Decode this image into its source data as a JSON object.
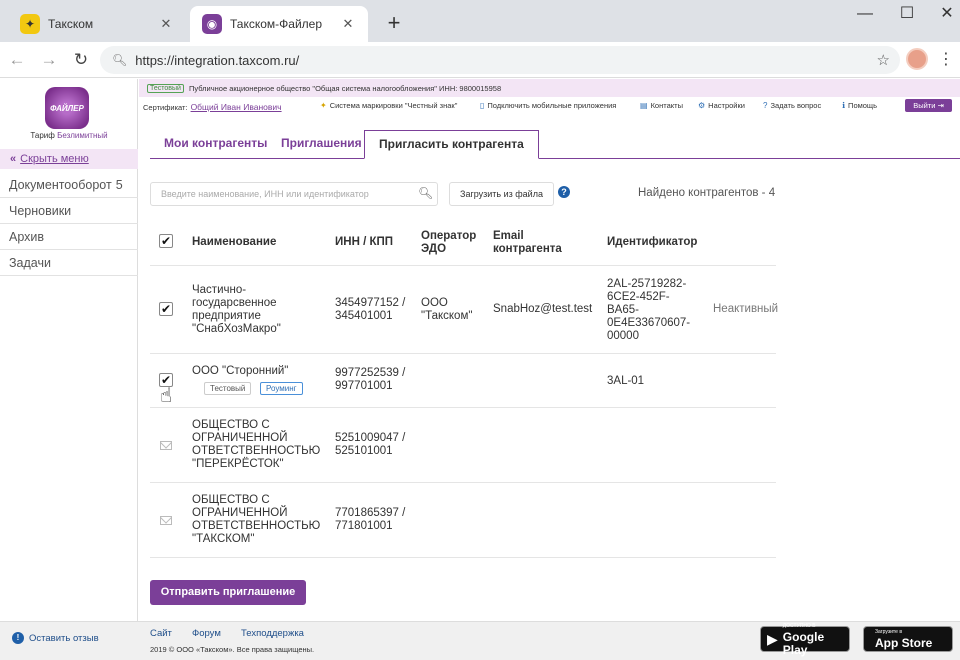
{
  "browser": {
    "tabs": [
      {
        "title": "Такском",
        "active": false
      },
      {
        "title": "Такском-Файлер",
        "active": true
      }
    ],
    "url": "https://integration.taxcom.ru/"
  },
  "sidebar": {
    "logo_text": "ФАЙЛЕР",
    "tariff_label": "Тариф",
    "tariff_value": "Безлимитный",
    "collapse_label": "Скрыть меню",
    "items": [
      {
        "label": "Документооборот",
        "count": "5"
      },
      {
        "label": "Черновики",
        "count": ""
      },
      {
        "label": "Архив",
        "count": ""
      },
      {
        "label": "Задачи",
        "count": ""
      }
    ]
  },
  "header": {
    "test_badge": "Тестовый",
    "org_info": "Публичное акционерное общество \"Общая система налогообложения\" ИНН: 9800015958",
    "cert_label": "Сертификат:",
    "cert_name": "Общий Иван Иванович",
    "links": {
      "marking": "Система маркировки \"Честный знак\"",
      "mobile": "Подключить мобильные приложения",
      "contacts": "Контакты",
      "settings": "Настройки",
      "ask": "Задать вопрос",
      "help": "Помощь"
    },
    "exit_label": "Выйти"
  },
  "tabs": {
    "counterparties": "Мои контрагенты",
    "invitations": "Приглашения",
    "invite": "Пригласить контрагента"
  },
  "search": {
    "placeholder": "Введите наименование, ИНН или идентификатор",
    "upload_label": "Загрузить из файла",
    "found_label": "Найдено контрагентов - 4"
  },
  "table": {
    "headers": {
      "name": "Наименование",
      "inn": "ИНН / КПП",
      "operator_1": "Оператор",
      "operator_2": "ЭДО",
      "email_1": "Email",
      "email_2": "контрагента",
      "id": "Идентификатор"
    },
    "rows": [
      {
        "name_lines": [
          "Частично-",
          "государсвенное",
          "предприятие",
          "\"СнабХозМакро\""
        ],
        "inn": "3454977152 /",
        "kpp": "345401001",
        "operator_1": "ООО",
        "operator_2": "\"Такском\"",
        "email": "SnabHoz@test.test",
        "id_lines": [
          "2AL-25719282-",
          "6CE2-452F-",
          "BA65-",
          "0E4E33670607-",
          "00000"
        ],
        "status": "Неактивный"
      },
      {
        "name_lines": [
          "ООО \"Сторонний\""
        ],
        "tag_test": "Тестовый",
        "tag_roaming": "Роуминг",
        "inn": "9977252539 /",
        "kpp": "997701001",
        "id_lines": [
          "3AL-01"
        ]
      },
      {
        "name_lines": [
          "ОБЩЕСТВО С",
          "ОГРАНИЧЕННОЙ",
          "ОТВЕТСТВЕННОСТЬЮ",
          "\"ПЕРЕКРЁСТОК\""
        ],
        "inn": "5251009047 /",
        "kpp": "525101001"
      },
      {
        "name_lines": [
          "ОБЩЕСТВО С",
          "ОГРАНИЧЕННОЙ",
          "ОТВЕТСТВЕННОСТЬЮ",
          "\"ТАКСКОМ\""
        ],
        "inn": "7701865397 /",
        "kpp": "771801001"
      }
    ]
  },
  "send_button": "Отправить приглашение",
  "footer": {
    "feedback": "Оставить отзыв",
    "links": [
      "Сайт",
      "Форум",
      "Техподдержка"
    ],
    "copyright": "2019 © ООО «Такском». Все права защищены.",
    "google_small": "ДОСТУПНО В",
    "google_big": "Google Play",
    "apple_small": "Загрузите в",
    "apple_big": "App Store"
  },
  "colors": {
    "accent": "#7b3f98",
    "accent_light": "#f3e5f5",
    "link_blue": "#1f4e8a"
  }
}
